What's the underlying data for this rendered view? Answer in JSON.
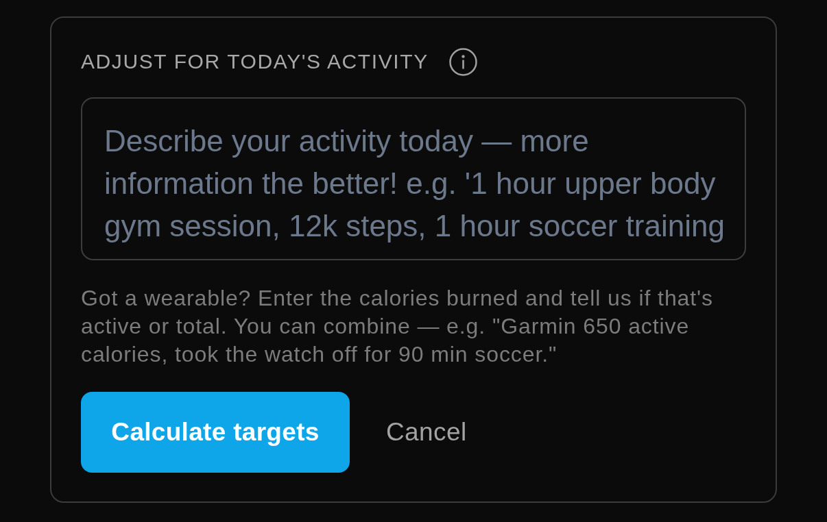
{
  "activity_panel": {
    "heading": "ADJUST FOR TODAY'S ACTIVITY",
    "activity_field": {
      "placeholder": "Describe your activity today — more information the better! e.g. '1 hour upper body gym session, 12k steps, 1 hour soccer training"
    },
    "hint": "Got a wearable? Enter the calories burned and tell us if that's active or total. You can combine — e.g. \"Garmin 650 active calories, took the watch off for 90 min soccer.\"",
    "buttons": [
      {
        "kind": "primary",
        "label": "Calculate targets"
      },
      {
        "kind": "text",
        "label": "Cancel"
      }
    ]
  }
}
